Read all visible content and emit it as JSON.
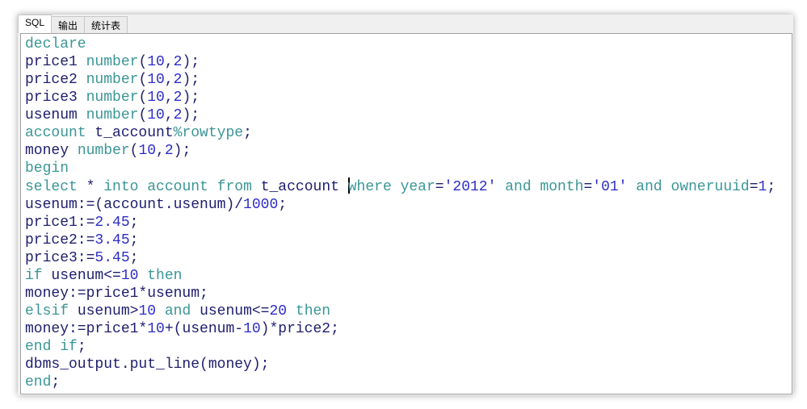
{
  "tabs": [
    "SQL",
    "输出",
    "统计表"
  ],
  "active_tab": 0,
  "colors": {
    "keyword": "#3b9696",
    "identifier": "#1e1e6e",
    "literal": "#2d2dc8"
  },
  "cursor": {
    "line": 8,
    "token": 9
  },
  "lines": [
    [
      [
        "k",
        "declare"
      ]
    ],
    [
      [
        "i",
        "price1 "
      ],
      [
        "k",
        "number"
      ],
      [
        "i",
        "("
      ],
      [
        "n",
        "10"
      ],
      [
        "i",
        ","
      ],
      [
        "n",
        "2"
      ],
      [
        "i",
        ");"
      ]
    ],
    [
      [
        "i",
        "price2 "
      ],
      [
        "k",
        "number"
      ],
      [
        "i",
        "("
      ],
      [
        "n",
        "10"
      ],
      [
        "i",
        ","
      ],
      [
        "n",
        "2"
      ],
      [
        "i",
        ");"
      ]
    ],
    [
      [
        "i",
        "price3 "
      ],
      [
        "k",
        "number"
      ],
      [
        "i",
        "("
      ],
      [
        "n",
        "10"
      ],
      [
        "i",
        ","
      ],
      [
        "n",
        "2"
      ],
      [
        "i",
        ");"
      ]
    ],
    [
      [
        "i",
        "usenum "
      ],
      [
        "k",
        "number"
      ],
      [
        "i",
        "("
      ],
      [
        "n",
        "10"
      ],
      [
        "i",
        ","
      ],
      [
        "n",
        "2"
      ],
      [
        "i",
        ");"
      ]
    ],
    [
      [
        "k",
        "account"
      ],
      [
        "i",
        " t_account"
      ],
      [
        "k",
        "%rowtype"
      ],
      [
        "i",
        ";"
      ]
    ],
    [
      [
        "i",
        "money "
      ],
      [
        "k",
        "number"
      ],
      [
        "i",
        "("
      ],
      [
        "n",
        "10"
      ],
      [
        "i",
        ","
      ],
      [
        "n",
        "2"
      ],
      [
        "i",
        ");"
      ]
    ],
    [
      [
        "k",
        "begin"
      ]
    ],
    [
      [
        "k",
        "select"
      ],
      [
        "i",
        " * "
      ],
      [
        "k",
        "into"
      ],
      [
        "i",
        " "
      ],
      [
        "k",
        "account"
      ],
      [
        "i",
        " "
      ],
      [
        "k",
        "from"
      ],
      [
        "i",
        " t_account "
      ],
      [
        "k",
        ""
      ],
      [
        "k",
        "where"
      ],
      [
        "i",
        " "
      ],
      [
        "k",
        "year"
      ],
      [
        "i",
        "="
      ],
      [
        "n",
        "'2012'"
      ],
      [
        "i",
        " "
      ],
      [
        "k",
        "and"
      ],
      [
        "i",
        " "
      ],
      [
        "k",
        "month"
      ],
      [
        "i",
        "="
      ],
      [
        "n",
        "'01'"
      ],
      [
        "i",
        " "
      ],
      [
        "k",
        "and"
      ],
      [
        "i",
        " "
      ],
      [
        "k",
        "owneruuid"
      ],
      [
        "i",
        "="
      ],
      [
        "n",
        "1"
      ],
      [
        "i",
        ";"
      ]
    ],
    [
      [
        "i",
        "usenum:=(account.usenum)/"
      ],
      [
        "n",
        "1000"
      ],
      [
        "i",
        ";"
      ]
    ],
    [
      [
        "i",
        "price1:="
      ],
      [
        "n",
        "2.45"
      ],
      [
        "i",
        ";"
      ]
    ],
    [
      [
        "i",
        "price2:="
      ],
      [
        "n",
        "3.45"
      ],
      [
        "i",
        ";"
      ]
    ],
    [
      [
        "i",
        "price3:="
      ],
      [
        "n",
        "5.45"
      ],
      [
        "i",
        ";"
      ]
    ],
    [
      [
        "k",
        "if"
      ],
      [
        "i",
        " usenum<="
      ],
      [
        "n",
        "10"
      ],
      [
        "i",
        " "
      ],
      [
        "k",
        "then"
      ]
    ],
    [
      [
        "i",
        "money:=price1*usenum;"
      ]
    ],
    [
      [
        "k",
        "elsif"
      ],
      [
        "i",
        " usenum>"
      ],
      [
        "n",
        "10"
      ],
      [
        "i",
        " "
      ],
      [
        "k",
        "and"
      ],
      [
        "i",
        " usenum<="
      ],
      [
        "n",
        "20"
      ],
      [
        "i",
        " "
      ],
      [
        "k",
        "then"
      ]
    ],
    [
      [
        "i",
        "money:=price1*"
      ],
      [
        "n",
        "10"
      ],
      [
        "i",
        "+(usenum-"
      ],
      [
        "n",
        "10"
      ],
      [
        "i",
        ")*price2;"
      ]
    ],
    [
      [
        "k",
        "end"
      ],
      [
        "i",
        " "
      ],
      [
        "k",
        "if"
      ],
      [
        "i",
        ";"
      ]
    ],
    [
      [
        "i",
        "dbms_output.put_line(money);"
      ]
    ],
    [
      [
        "k",
        "end"
      ],
      [
        "i",
        ";"
      ]
    ]
  ]
}
